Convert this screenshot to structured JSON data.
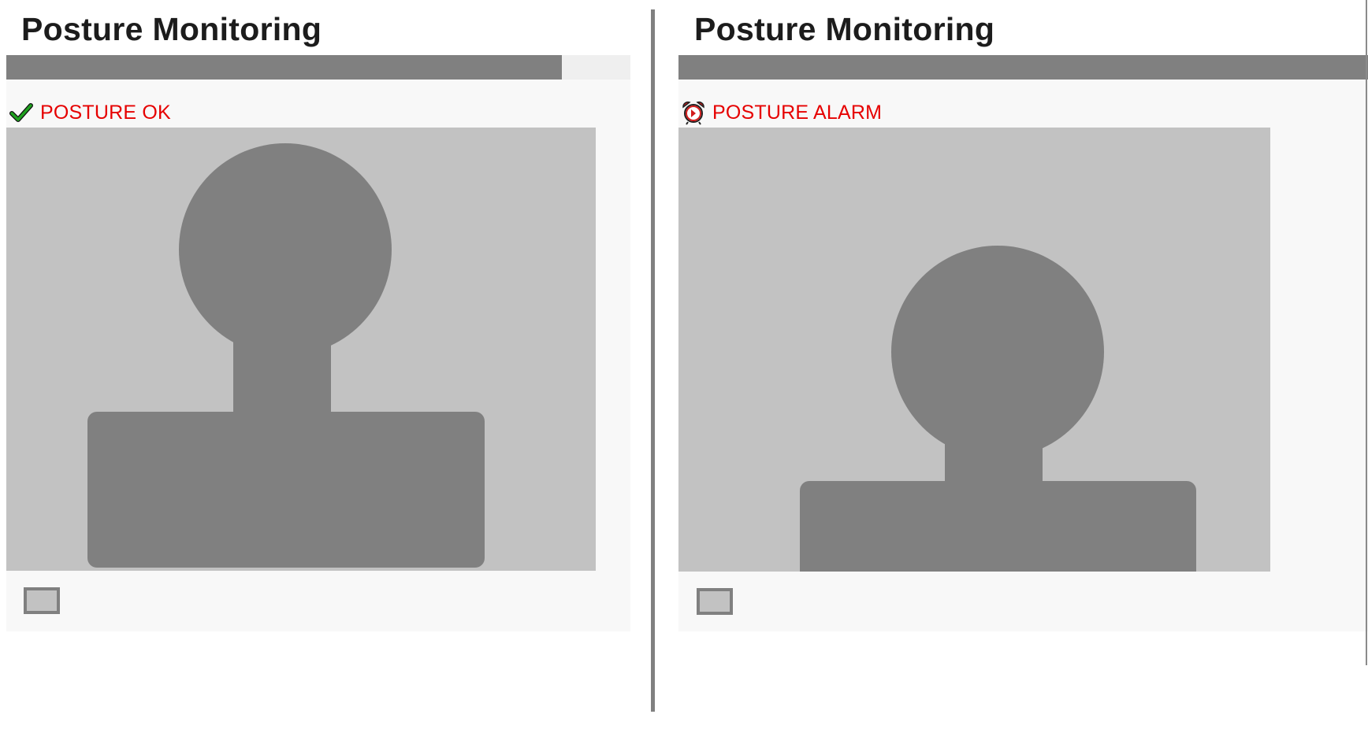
{
  "colors": {
    "progress_fill": "#808080",
    "progress_track": "#efefef",
    "status_text": "#e60000",
    "camera_bg": "#c2c2c2",
    "silhouette": "#808080",
    "card_bg": "#f8f8f8",
    "ok_check": "#1fa11f",
    "alarm_clock": "#d21c1c"
  },
  "panels": [
    {
      "title": "Posture Monitoring",
      "progress": 0.89,
      "status_icon": "checkmark-icon",
      "status_text": "POSTURE OK",
      "capture_button_icon": "camera-capture-icon"
    },
    {
      "title": "Posture Monitoring",
      "progress": 1.0,
      "status_icon": "alarm-clock-icon",
      "status_text": "POSTURE ALARM",
      "capture_button_icon": "camera-capture-icon"
    }
  ]
}
